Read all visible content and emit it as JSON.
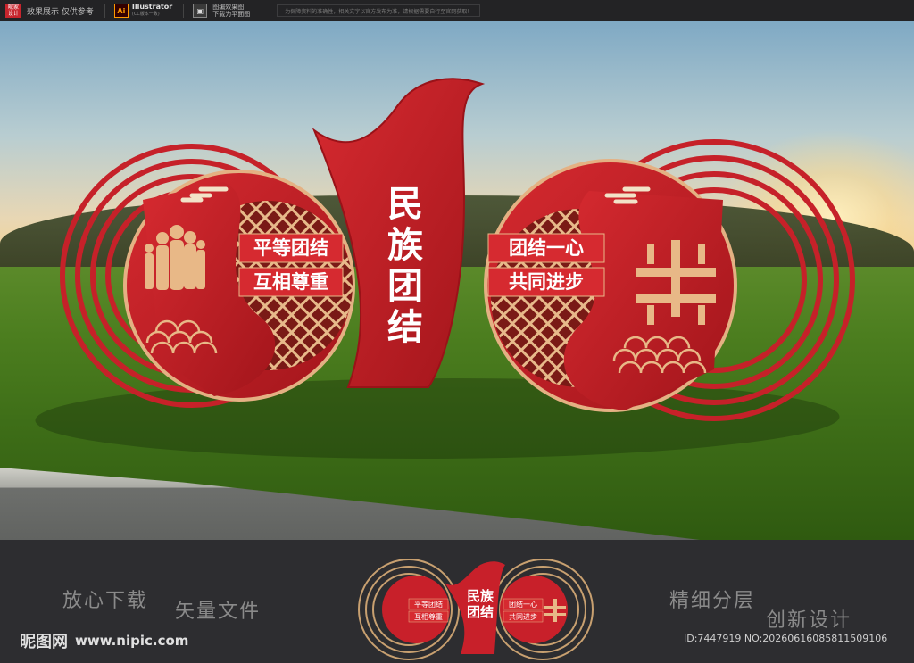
{
  "topbar": {
    "badge": "昵家\n设计",
    "preview_note": "效果展示 仅供参考",
    "app_icon": "Ai",
    "app_name": "Illustrator",
    "app_sub": "(CC版本一致)",
    "img_icon": "image-icon",
    "img_note": "图编效果图\n下载为平面图",
    "notice": "为保障资料的准确性，相关文字以官方发布为准，请根据需要自行至官网获取！"
  },
  "sign": {
    "center_text": [
      "民",
      "族",
      "团",
      "结"
    ],
    "left_slogans": [
      "平等团结",
      "互相尊重"
    ],
    "right_slogans": [
      "团结一心",
      "共同进步"
    ]
  },
  "banner": {
    "slogans": [
      "放心下载",
      "矢量文件",
      "精细分层",
      "创新设计"
    ],
    "brand_name": "昵图网",
    "brand_url": "www.nipic.com",
    "image_id": "ID:7447919 NO:20260616085811509106"
  },
  "colors": {
    "red": "#c8202a",
    "gold": "#e8b887",
    "dark_red": "#8e1219"
  }
}
